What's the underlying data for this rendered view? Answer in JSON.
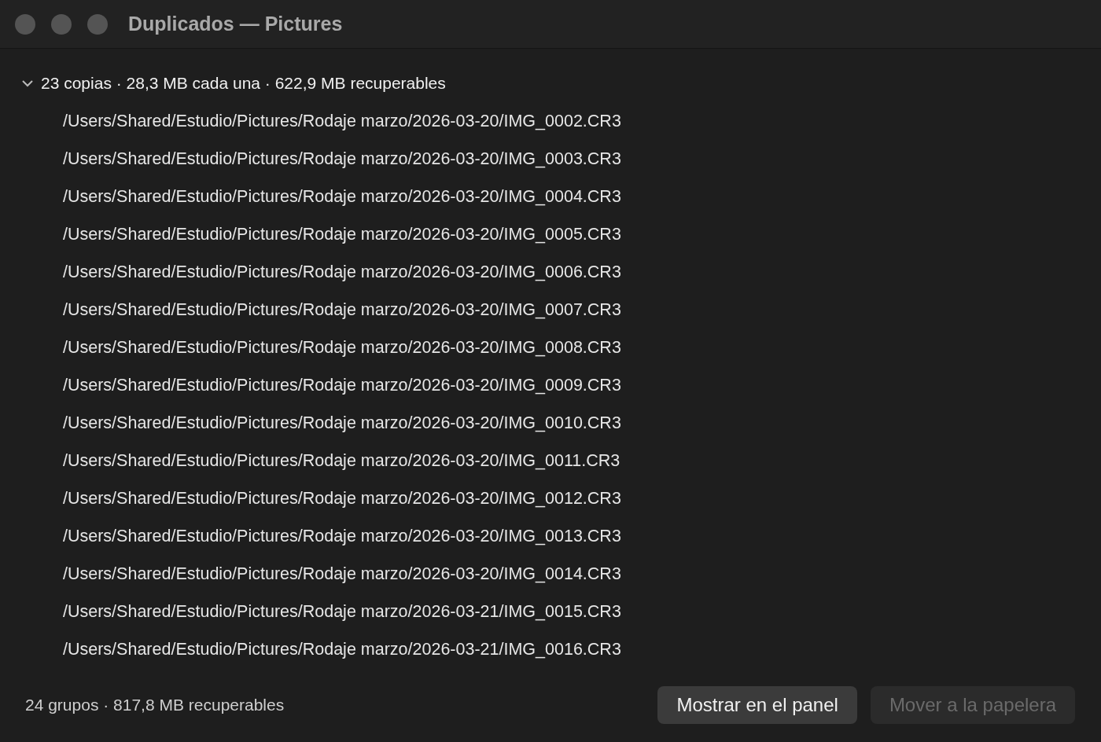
{
  "window": {
    "title": "Duplicados — Pictures"
  },
  "group": {
    "expanded": true,
    "summary": "23 copias · 28,3 MB cada una · 622,9 MB recuperables",
    "files": [
      "/Users/Shared/Estudio/Pictures/Rodaje marzo/2026-03-20/IMG_0002.CR3",
      "/Users/Shared/Estudio/Pictures/Rodaje marzo/2026-03-20/IMG_0003.CR3",
      "/Users/Shared/Estudio/Pictures/Rodaje marzo/2026-03-20/IMG_0004.CR3",
      "/Users/Shared/Estudio/Pictures/Rodaje marzo/2026-03-20/IMG_0005.CR3",
      "/Users/Shared/Estudio/Pictures/Rodaje marzo/2026-03-20/IMG_0006.CR3",
      "/Users/Shared/Estudio/Pictures/Rodaje marzo/2026-03-20/IMG_0007.CR3",
      "/Users/Shared/Estudio/Pictures/Rodaje marzo/2026-03-20/IMG_0008.CR3",
      "/Users/Shared/Estudio/Pictures/Rodaje marzo/2026-03-20/IMG_0009.CR3",
      "/Users/Shared/Estudio/Pictures/Rodaje marzo/2026-03-20/IMG_0010.CR3",
      "/Users/Shared/Estudio/Pictures/Rodaje marzo/2026-03-20/IMG_0011.CR3",
      "/Users/Shared/Estudio/Pictures/Rodaje marzo/2026-03-20/IMG_0012.CR3",
      "/Users/Shared/Estudio/Pictures/Rodaje marzo/2026-03-20/IMG_0013.CR3",
      "/Users/Shared/Estudio/Pictures/Rodaje marzo/2026-03-20/IMG_0014.CR3",
      "/Users/Shared/Estudio/Pictures/Rodaje marzo/2026-03-21/IMG_0015.CR3",
      "/Users/Shared/Estudio/Pictures/Rodaje marzo/2026-03-21/IMG_0016.CR3"
    ]
  },
  "status_bar": {
    "summary": "24 grupos · 817,8 MB recuperables"
  },
  "buttons": [
    {
      "label": "Mostrar en el panel",
      "disabled": false
    },
    {
      "label": "Mover a la papelera",
      "disabled": true
    }
  ]
}
